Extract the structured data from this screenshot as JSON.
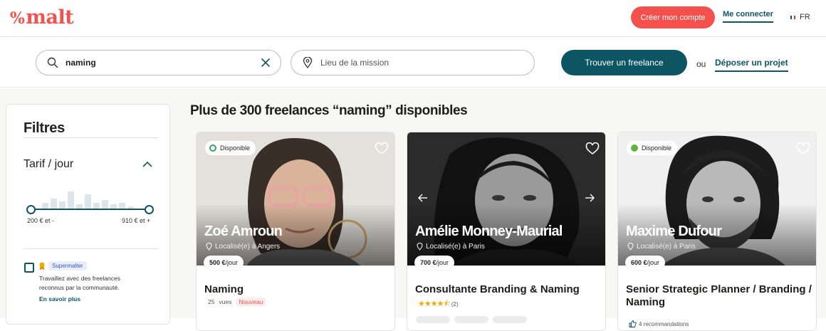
{
  "header": {
    "logo_text": "malt",
    "signup_label": "Créer mon compte",
    "login_label": "Me connecter",
    "language": "FR"
  },
  "search": {
    "query_value": "naming",
    "location_placeholder": "Lieu de la mission",
    "find_button": "Trouver un freelance",
    "or_text": "ou",
    "post_project": "Déposer un projet"
  },
  "filters": {
    "title": "Filtres",
    "rate": {
      "title": "Tarif / jour",
      "min_label": "200 € et -",
      "max_label": "910 € et +"
    },
    "supermalter": {
      "badge": "Supermalter",
      "description": "Travaillez avec des freelances reconnus par la communauté.",
      "learn_more": "En savoir plus"
    }
  },
  "results": {
    "title": "Plus de 300 freelances “naming” disponibles",
    "cards": [
      {
        "availability": "Disponible",
        "name": "Zoé Amroun",
        "location": "Localisé(e) à Angers",
        "price": "500 €",
        "price_unit": "/jour",
        "job_title": "Naming",
        "views_count": "25",
        "views_label": "vues",
        "new_tag": "Nouveau"
      },
      {
        "name": "Amélie Monney-Maurial",
        "location": "Localisé(e) à Paris",
        "price": "700 €",
        "price_unit": "/jour",
        "job_title": "Consultante Branding & Naming",
        "rating_count": "(2)",
        "rating": 4.5
      },
      {
        "availability": "Disponible",
        "name": "Maxime Dufour",
        "location": "Localisé(e) à Paris",
        "price": "600 €",
        "price_unit": "/jour",
        "job_title": "Senior Strategic Planner / Branding / Naming",
        "recommendations": "4 recommandations"
      }
    ]
  },
  "colors": {
    "brand": "#f5514c",
    "primary": "#0e5563",
    "available": "#62b143"
  }
}
